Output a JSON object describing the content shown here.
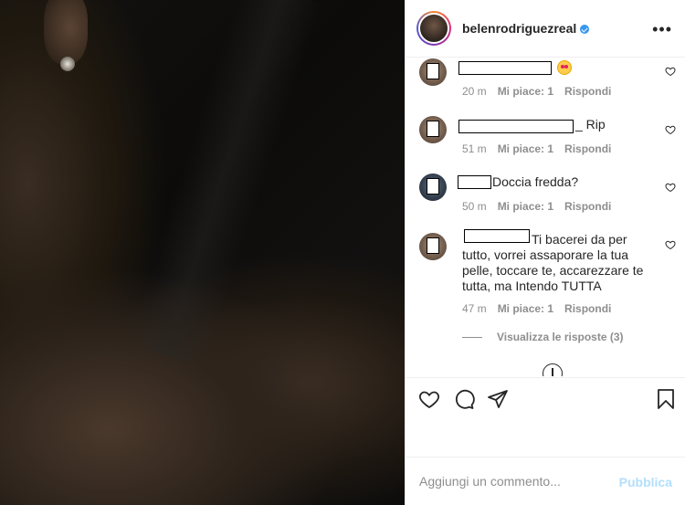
{
  "header": {
    "username": "belenrodriguezreal"
  },
  "comments": [
    {
      "text": "",
      "time": "20 m",
      "likes": "Mi piace: 1",
      "reply": "Rispondi"
    },
    {
      "text": "_ Rip",
      "time": "51 m",
      "likes": "Mi piace: 1",
      "reply": "Rispondi"
    },
    {
      "text": "Doccia fredda?",
      "time": "50 m",
      "likes": "Mi piace: 1",
      "reply": "Rispondi"
    },
    {
      "text": "Ti bacerei da per tutto, vorrei assaporare la tua pelle, toccare te, accarezzare te tutta, ma Intendo TUTTA",
      "time": "47 m",
      "likes": "Mi piace: 1",
      "reply": "Rispondi"
    }
  ],
  "view_replies": "Visualizza le risposte (3)",
  "add_comment": {
    "placeholder": "Aggiungi un commento...",
    "post_label": "Pubblica"
  },
  "colors": {
    "accent_link": "#b2dffc",
    "verified": "#3897f0",
    "meta_text": "#8e8e8e"
  }
}
